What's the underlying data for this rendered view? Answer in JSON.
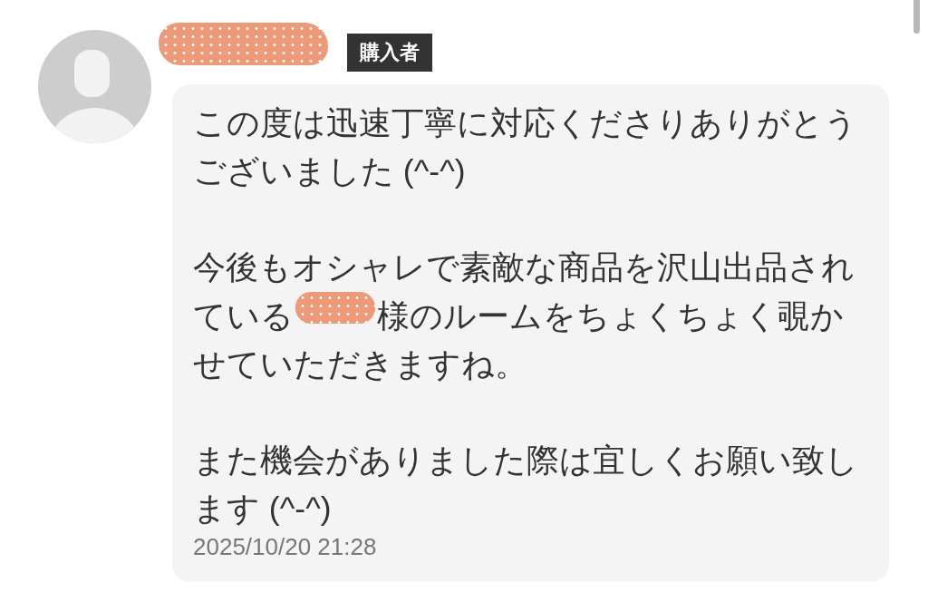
{
  "review": {
    "author": {
      "name": {
        "kind": "redaction"
      },
      "badge": "購入者"
    },
    "message": {
      "paragraphs": [
        {
          "lines": [
            {
              "segments": [
                {
                  "kind": "text",
                  "text": "この度は迅速丁寧に対応くださりありがとうございました (^-^)"
                }
              ]
            }
          ]
        },
        {
          "lines": [
            {
              "segments": [
                {
                  "kind": "text",
                  "text": "今後もオシャレで素敵な商品を沢山出品され"
                }
              ]
            },
            {
              "segments": [
                {
                  "kind": "text",
                  "text": "ている"
                },
                {
                  "kind": "redaction"
                },
                {
                  "kind": "text",
                  "text": "様のルームをちょくちょく覗か"
                }
              ]
            },
            {
              "segments": [
                {
                  "kind": "text",
                  "text": "せていただきますね。"
                }
              ]
            }
          ]
        },
        {
          "lines": [
            {
              "segments": [
                {
                  "kind": "text",
                  "text": "また機会がありました際は宜しくお願い致します (^-^)"
                }
              ]
            }
          ]
        }
      ]
    },
    "timestamp": "2025/10/20 21:28"
  }
}
